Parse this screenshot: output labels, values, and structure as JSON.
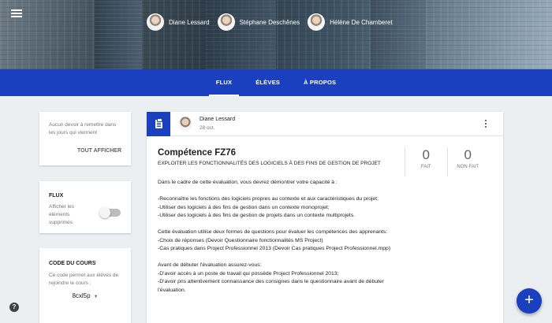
{
  "header": {
    "teachers": [
      {
        "name": "Diane Lessard"
      },
      {
        "name": "Stéphane Deschênes"
      },
      {
        "name": "Hélène De Chamberet"
      }
    ]
  },
  "tabs": [
    {
      "label": "FLUX",
      "active": true
    },
    {
      "label": "ÉLÈVES",
      "active": false
    },
    {
      "label": "À PROPOS",
      "active": false
    }
  ],
  "upcoming": {
    "message": "Aucun devoir à remettre dans les jours qui viennent",
    "button": "TOUT AFFICHER"
  },
  "stream": {
    "title": "FLUX",
    "toggle_label": "Afficher les éléments supprimés",
    "toggle_on": false
  },
  "course_code": {
    "title": "CODE DU COURS",
    "description": "Ce code permet aux élèves de rejoindre le cours :",
    "code": "8cxl5p"
  },
  "post": {
    "author": "Diane Lessard",
    "date": "28 oct.",
    "title": "Compétence FZ76",
    "subtitle": "EXPLOITER LES FONCTIONNALITÉS DES LOGICIELS À DES FINS DE GESTION DE PROJET",
    "stats": [
      {
        "value": "0",
        "label": "FAIT"
      },
      {
        "value": "0",
        "label": "NON FAIT"
      }
    ],
    "body": [
      "Dans le cadre de cette évaluation, vous devrez démontrer votre capacité à :",
      "",
      "-Reconnaître les fonctions des logiciels propres au contexte et aux caractéristiques du projet;",
      "-Utiliser des logiciels à des fins de gestion dans un contexte monoprojet;",
      "-Utiliser des logiciels à des fins de gestion de projets dans un contexte multiprojets.",
      "",
      "Cette évaluation utilise deux formes de questions pour évaluer les compétences des apprenants:",
      "-Choix de réponses (Devoir Questionnaire fonctionnalités MS Project)",
      "-Cas pratiques dans Project Professionnel 2013 (Devoir Cas pratiques Project Professionnel.mpp)",
      "",
      "Avant de débuter l'évaluation assurez-vous:",
      "-D'avoir accès à un poste de travail qui possède Project Professionnel 2013;",
      "-D'avoir pris attentivement connaissance des consignes dans le questionnaire avant de débuter l'évaluation."
    ]
  },
  "help_icon": "help-icon",
  "fab_icon": "plus-icon",
  "colors": {
    "accent": "#1a3fbf",
    "background": "#eceff1"
  }
}
